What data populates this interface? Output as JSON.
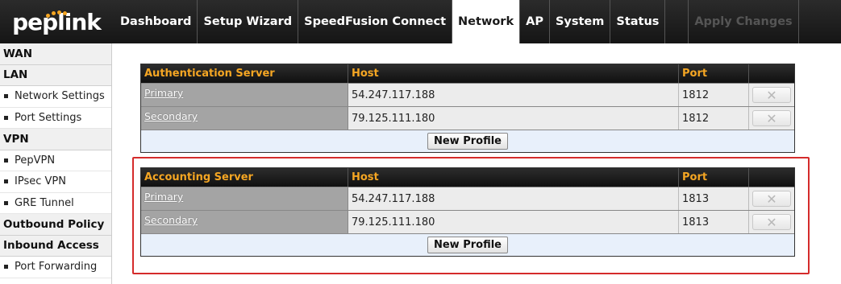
{
  "brand": {
    "logo_text": "peplink",
    "accent": "#f5a623"
  },
  "nav": {
    "items": [
      "Dashboard",
      "Setup Wizard",
      "SpeedFusion Connect",
      "Network",
      "AP",
      "System",
      "Status"
    ],
    "active": "Network",
    "apply_label": "Apply Changes"
  },
  "sidebar": {
    "wan": "WAN",
    "lan": "LAN",
    "lan_items": [
      "Network Settings",
      "Port Settings"
    ],
    "vpn": "VPN",
    "vpn_items": [
      "PepVPN",
      "IPsec VPN",
      "GRE Tunnel"
    ],
    "outbound": "Outbound Policy",
    "inbound": "Inbound Access",
    "inbound_items": [
      "Port Forwarding"
    ]
  },
  "auth": {
    "headers": [
      "Authentication Server",
      "Host",
      "Port"
    ],
    "rows": [
      {
        "name": "Primary",
        "host": "54.247.117.188",
        "port": "1812"
      },
      {
        "name": "Secondary",
        "host": "79.125.111.180",
        "port": "1812"
      }
    ],
    "new_profile": "New Profile"
  },
  "acct": {
    "headers": [
      "Accounting Server",
      "Host",
      "Port"
    ],
    "rows": [
      {
        "name": "Primary",
        "host": "54.247.117.188",
        "port": "1813"
      },
      {
        "name": "Secondary",
        "host": "79.125.111.180",
        "port": "1813"
      }
    ],
    "new_profile": "New Profile"
  },
  "delete_glyph": "✕",
  "highlight_color": "#d42b2b"
}
